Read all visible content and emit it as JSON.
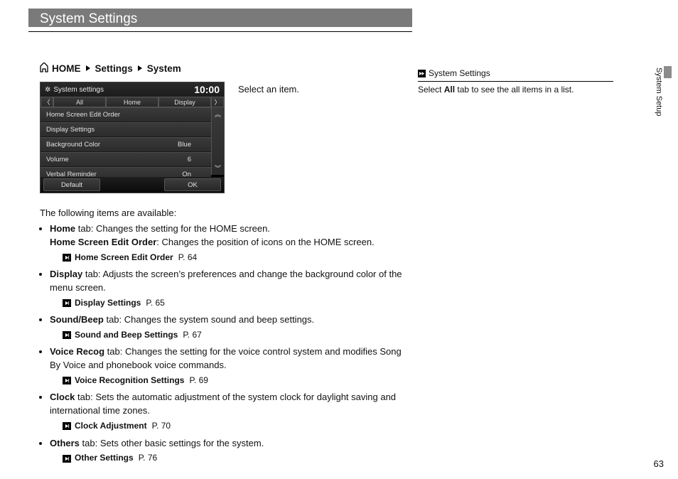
{
  "page_title": "System Settings",
  "side_tab": "System Setup",
  "breadcrumb": {
    "root": "HOME",
    "mid": "Settings",
    "leaf": "System"
  },
  "select_instruction": "Select an item.",
  "screenshot": {
    "header_title": "System settings",
    "clock": "10:00",
    "tabs": [
      "All",
      "Home",
      "Display"
    ],
    "rows": [
      {
        "label": "Home Screen Edit Order",
        "value": ""
      },
      {
        "label": "Display Settings",
        "value": ""
      },
      {
        "label": "Background Color",
        "value": "Blue"
      },
      {
        "label": "Volume",
        "value": "6"
      },
      {
        "label": "Verbal Reminder",
        "value": "On"
      }
    ],
    "bottom_left": "Default",
    "bottom_right": "OK"
  },
  "intro": "The following items are available:",
  "items": [
    {
      "tab_bold": "Home",
      "tab_rest": " tab: Changes the setting for the HOME screen.",
      "line2_bold": "Home Screen Edit Order",
      "line2_rest": ": Changes the position of icons on the HOME screen.",
      "xref_text": "Home Screen Edit Order",
      "xref_page": "P. 64"
    },
    {
      "tab_bold": "Display",
      "tab_rest": " tab: Adjusts the screen’s preferences and change the background color of the menu screen.",
      "xref_text": "Display Settings",
      "xref_page": "P. 65"
    },
    {
      "tab_bold": "Sound/Beep",
      "tab_rest": " tab: Changes the system sound and beep settings.",
      "xref_text": "Sound and Beep Settings",
      "xref_page": "P. 67"
    },
    {
      "tab_bold": "Voice Recog",
      "tab_rest": " tab: Changes the setting for the voice control system and modifies Song By Voice and phonebook voice commands.",
      "xref_text": "Voice Recognition Settings",
      "xref_page": "P. 69"
    },
    {
      "tab_bold": "Clock",
      "tab_rest": " tab: Sets the automatic adjustment of the system clock for daylight saving and international time zones.",
      "xref_text": "Clock Adjustment",
      "xref_page": "P. 70"
    },
    {
      "tab_bold": "Others",
      "tab_rest": " tab: Sets other basic settings for the system.",
      "xref_text": "Other Settings",
      "xref_page": "P. 76"
    }
  ],
  "sidebar_note": {
    "title": "System Settings",
    "body_pre": "Select ",
    "body_bold": "All",
    "body_post": " tab to see the all items in a list."
  },
  "page_number": "63"
}
